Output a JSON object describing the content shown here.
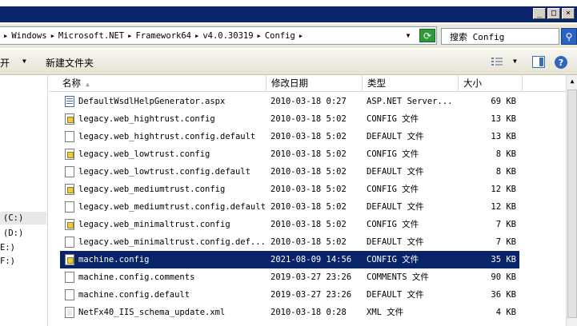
{
  "window": {
    "buttons": {
      "minimize": "_",
      "maximize": "□",
      "close": "×"
    }
  },
  "address": {
    "crumbs": [
      "Windows",
      "Microsoft.NET",
      "Framework64",
      "v4.0.30319",
      "Config"
    ],
    "leading_separator": "▸",
    "separator": "▸"
  },
  "search": {
    "label": "搜索 Config"
  },
  "toolbar": {
    "open_label": "打开",
    "new_folder_label": "新建文件夹"
  },
  "nav": {
    "items": [
      {
        "label": "(C:)",
        "selected": true
      },
      {
        "label": "(D:)",
        "selected": false
      },
      {
        "label": "E:)",
        "selected": false
      },
      {
        "label": "F:)",
        "selected": false
      }
    ]
  },
  "columns": {
    "name": "名称",
    "date": "修改日期",
    "type": "类型",
    "size": "大小"
  },
  "files": [
    {
      "icon": "aspx",
      "name": "DefaultWsdlHelpGenerator.aspx",
      "date": "2010-03-18 0:27",
      "type": "ASP.NET Server...",
      "size": "69 KB",
      "selected": false
    },
    {
      "icon": "cfg",
      "name": "legacy.web_hightrust.config",
      "date": "2010-03-18 5:02",
      "type": "CONFIG 文件",
      "size": "13 KB",
      "selected": false
    },
    {
      "icon": "doc",
      "name": "legacy.web_hightrust.config.default",
      "date": "2010-03-18 5:02",
      "type": "DEFAULT 文件",
      "size": "13 KB",
      "selected": false
    },
    {
      "icon": "cfg",
      "name": "legacy.web_lowtrust.config",
      "date": "2010-03-18 5:02",
      "type": "CONFIG 文件",
      "size": "8 KB",
      "selected": false
    },
    {
      "icon": "doc",
      "name": "legacy.web_lowtrust.config.default",
      "date": "2010-03-18 5:02",
      "type": "DEFAULT 文件",
      "size": "8 KB",
      "selected": false
    },
    {
      "icon": "cfg",
      "name": "legacy.web_mediumtrust.config",
      "date": "2010-03-18 5:02",
      "type": "CONFIG 文件",
      "size": "12 KB",
      "selected": false
    },
    {
      "icon": "doc",
      "name": "legacy.web_mediumtrust.config.default",
      "date": "2010-03-18 5:02",
      "type": "DEFAULT 文件",
      "size": "12 KB",
      "selected": false
    },
    {
      "icon": "cfg",
      "name": "legacy.web_minimaltrust.config",
      "date": "2010-03-18 5:02",
      "type": "CONFIG 文件",
      "size": "7 KB",
      "selected": false
    },
    {
      "icon": "doc",
      "name": "legacy.web_minimaltrust.config.def...",
      "date": "2010-03-18 5:02",
      "type": "DEFAULT 文件",
      "size": "7 KB",
      "selected": false
    },
    {
      "icon": "cfg",
      "name": "machine.config",
      "date": "2021-08-09 14:56",
      "type": "CONFIG 文件",
      "size": "35 KB",
      "selected": true
    },
    {
      "icon": "doc",
      "name": "machine.config.comments",
      "date": "2019-03-27 23:26",
      "type": "COMMENTS 文件",
      "size": "90 KB",
      "selected": false
    },
    {
      "icon": "doc",
      "name": "machine.config.default",
      "date": "2019-03-27 23:26",
      "type": "DEFAULT 文件",
      "size": "36 KB",
      "selected": false
    },
    {
      "icon": "xml",
      "name": "NetFx40_IIS_schema_update.xml",
      "date": "2010-03-18 0:28",
      "type": "XML 文件",
      "size": "4 KB",
      "selected": false
    }
  ],
  "colors": {
    "title_bar": "#0a246a",
    "selection": "#0a246a",
    "refresh_button": "#2e9a3a",
    "search_button": "#2a63c4"
  }
}
